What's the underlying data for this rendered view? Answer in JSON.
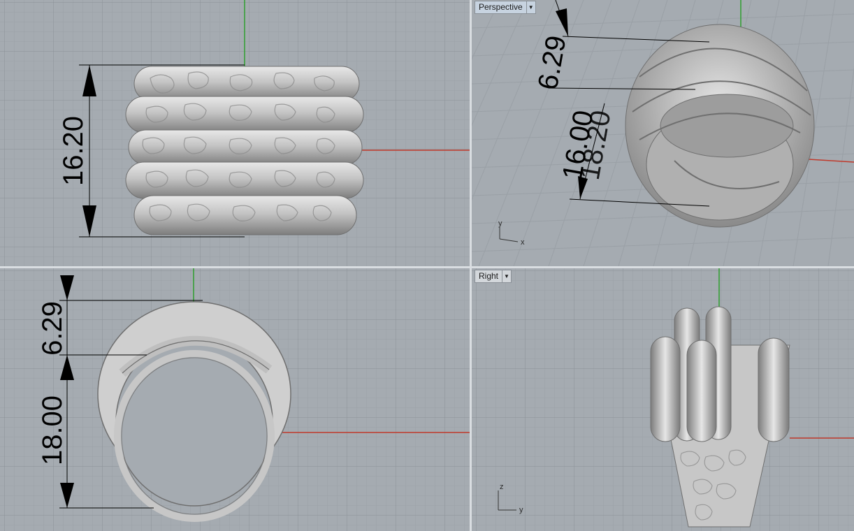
{
  "viewports": {
    "top": {
      "dimension": "16.20"
    },
    "perspective": {
      "title": "Perspective",
      "dim_upper": "6.29",
      "dim_lower_a": "16.00",
      "dim_lower_b": "18.20",
      "axis_x": "x",
      "axis_y": "y"
    },
    "front": {
      "dim_upper": "6.29",
      "dim_lower": "18.00"
    },
    "right": {
      "title": "Right",
      "axis_z": "z",
      "axis_y": "y"
    }
  },
  "colors": {
    "viewport_bg": "#a5abb1",
    "grid_minor": "#9aa0a6",
    "grid_major": "#8a9096",
    "axis_x": "#c0392b",
    "axis_y": "#2e9e2e",
    "model": "#c9c9c9",
    "active_tab": "#c7d3e0"
  },
  "icons": {
    "dropdown": "chevron-down-icon"
  }
}
